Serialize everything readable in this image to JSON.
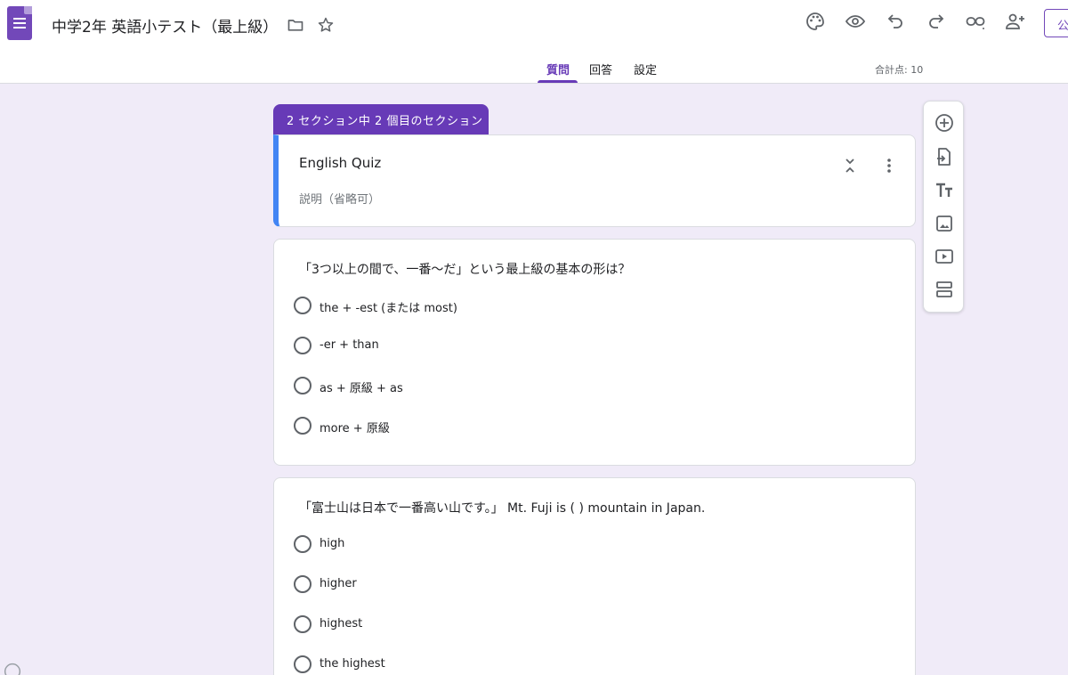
{
  "header": {
    "title": "中学2年 英語小テスト（最上級）",
    "publish_label": "公開",
    "tabs": [
      {
        "label": "質問",
        "active": true
      },
      {
        "label": "回答",
        "active": false
      },
      {
        "label": "設定",
        "active": false
      }
    ],
    "total_points": "合計点: 10",
    "icons": [
      "palette-icon",
      "preview-eye-icon",
      "undo-icon",
      "redo-icon",
      "link-icon",
      "add-collaborator-icon"
    ]
  },
  "section": {
    "badge": "2 セクション中 2 個目のセクション",
    "title": "English Quiz",
    "description_placeholder": "説明（省略可）"
  },
  "questions": [
    {
      "text": "「3つ以上の間で、一番〜だ」という最上級の基本の形は？",
      "options": [
        "the + -est (または most)",
        "-er + than",
        "as + 原級 + as",
        "more + 原級"
      ]
    },
    {
      "text": "「富士山は日本で一番高い山です。」 Mt. Fuji is ( ) mountain in Japan.",
      "options": [
        "high",
        "higher",
        "highest",
        "the highest"
      ]
    }
  ],
  "toolbar": [
    "add-question-icon",
    "import-questions-icon",
    "add-title-icon",
    "add-image-icon",
    "add-video-icon",
    "add-section-icon"
  ],
  "colors": {
    "accent": "#673ab7",
    "background": "#f0ebf8",
    "section_border": "#4285f4"
  }
}
